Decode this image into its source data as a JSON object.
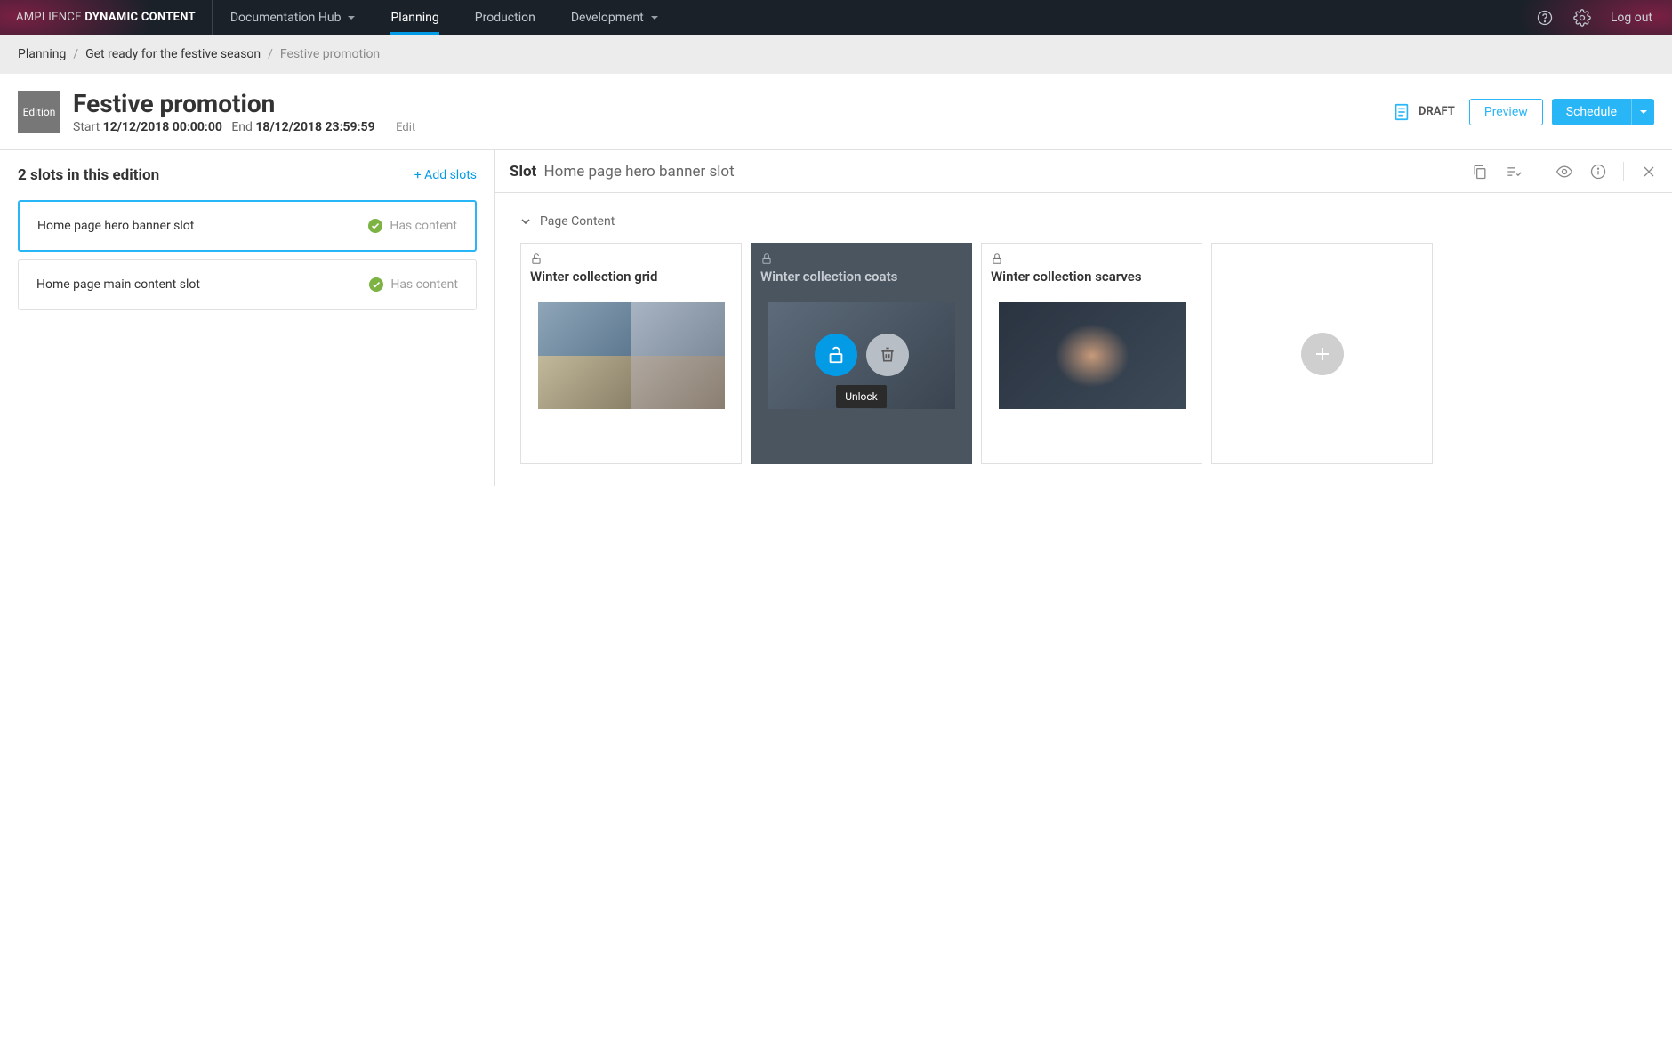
{
  "brand": {
    "light": "AMPLIENCE",
    "bold": "DYNAMIC CONTENT"
  },
  "nav": {
    "hub": "Documentation Hub",
    "planning": "Planning",
    "production": "Production",
    "development": "Development"
  },
  "top": {
    "logout": "Log out"
  },
  "crumbs": {
    "a": "Planning",
    "b": "Get ready for the festive season",
    "c": "Festive promotion"
  },
  "edition": {
    "badge": "Edition",
    "title": "Festive promotion",
    "startLabel": "Start",
    "startValue": "12/12/2018 00:00:00",
    "endLabel": "End",
    "endValue": "18/12/2018 23:59:59",
    "edit": "Edit",
    "status": "DRAFT",
    "preview": "Preview",
    "schedule": "Schedule"
  },
  "slots": {
    "heading": "2 slots in this edition",
    "add": "+ Add slots",
    "hasContent": "Has content",
    "items": [
      {
        "name": "Home page hero banner slot"
      },
      {
        "name": "Home page main content slot"
      }
    ]
  },
  "right": {
    "slotLabel": "Slot",
    "slotName": "Home page hero banner slot",
    "section": "Page Content",
    "cards": [
      {
        "title": "Winter collection grid"
      },
      {
        "title": "Winter collection coats"
      },
      {
        "title": "Winter collection scarves"
      }
    ],
    "unlockTooltip": "Unlock"
  }
}
